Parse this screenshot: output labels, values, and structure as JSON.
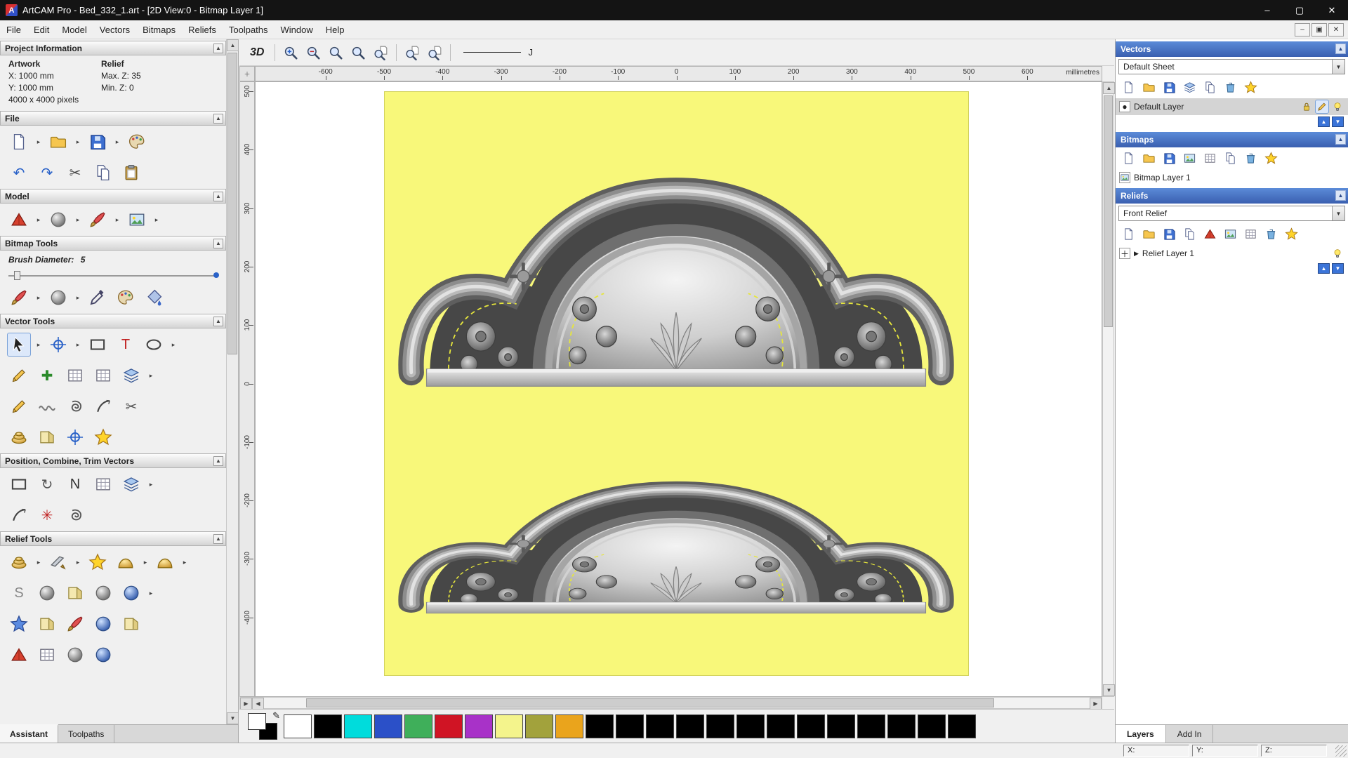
{
  "window": {
    "title": "ArtCAM Pro - Bed_332_1.art - [2D View:0 - Bitmap Layer 1]",
    "app_initial": "A",
    "minimize": "–",
    "maximize": "▢",
    "close": "✕",
    "mdi_minimize": "–",
    "mdi_restore": "▣",
    "mdi_close": "✕"
  },
  "menu_items": [
    "File",
    "Edit",
    "Model",
    "Vectors",
    "Bitmaps",
    "Reliefs",
    "Toolpaths",
    "Window",
    "Help"
  ],
  "toolbar": {
    "view_3d_label": "3D",
    "icons": [
      {
        "sep": true
      },
      {
        "name": "zoom-in-icon",
        "sym": "s-magplus"
      },
      {
        "name": "zoom-out-icon",
        "sym": "s-magminus"
      },
      {
        "name": "zoom-previous-icon",
        "sym": "s-mag"
      },
      {
        "name": "zoom-1to1-icon",
        "sym": "s-mag"
      },
      {
        "name": "zoom-selection-icon",
        "sym": "s-magpage"
      },
      {
        "sep": true
      },
      {
        "name": "zoom-fit-page-icon",
        "sym": "s-magpage"
      },
      {
        "name": "zoom-fit-drawing-icon",
        "sym": "s-magpage"
      }
    ]
  },
  "ruler": {
    "unit": "millimetres",
    "h_ticks": [
      -600,
      -500,
      -400,
      -300,
      -200,
      -100,
      0,
      100,
      200,
      300,
      400,
      500,
      600
    ],
    "v_ticks": [
      500,
      400,
      300,
      200,
      100,
      0,
      -100,
      -200,
      -300,
      -400
    ]
  },
  "left_panel": {
    "project_info": {
      "title": "Project Information",
      "artwork_heading": "Artwork",
      "relief_heading": "Relief",
      "artwork_x": "X: 1000 mm",
      "artwork_y": "Y: 1000 mm",
      "artwork_pixels": "4000 x 4000 pixels",
      "relief_max_z": "Max. Z: 35",
      "relief_min_z": "Min. Z: 0"
    },
    "sections": {
      "file": "File",
      "model": "Model",
      "bitmap_tools": "Bitmap Tools",
      "vector_tools": "Vector Tools",
      "position": "Position, Combine, Trim Vectors",
      "relief_tools": "Relief Tools"
    },
    "brush": {
      "label": "Brush Diameter:",
      "value": "5"
    },
    "icons": {
      "file_row1": [
        {
          "name": "new-model-icon",
          "sym": "s-page"
        },
        {
          "name": "flyout-arrow-icon",
          "glyph": "▸",
          "cls": "fly"
        },
        {
          "name": "open-model-icon",
          "sym": "s-folder"
        },
        {
          "name": "flyout-arrow-icon",
          "glyph": "▸",
          "cls": "fly"
        },
        {
          "name": "save-model-icon",
          "sym": "s-floppy"
        },
        {
          "name": "flyout-arrow-icon",
          "glyph": "▸",
          "cls": "fly"
        },
        {
          "name": "model-wizard-icon",
          "sym": "s-palette"
        }
      ],
      "file_row2": [
        {
          "name": "undo-icon",
          "glyph": "↶",
          "fg": "#2a62c8"
        },
        {
          "name": "redo-icon",
          "glyph": "↷",
          "fg": "#2a62c8"
        },
        {
          "name": "cut-icon",
          "glyph": "✂",
          "fg": "#444"
        },
        {
          "name": "copy-icon",
          "sym": "s-copy"
        },
        {
          "name": "paste-icon",
          "sym": "s-clipboard"
        }
      ],
      "model_row": [
        {
          "name": "set-model-size-icon",
          "sym": "s-pyramid"
        },
        {
          "name": "flyout-arrow-icon",
          "glyph": "▸",
          "cls": "fly"
        },
        {
          "name": "model-preview-icon",
          "sym": "s-sphere"
        },
        {
          "name": "flyout-arrow-icon",
          "glyph": "▸",
          "cls": "fly"
        },
        {
          "name": "scan-image-icon",
          "sym": "s-brush"
        },
        {
          "name": "flyout-arrow-icon",
          "glyph": "▸",
          "cls": "fly"
        },
        {
          "name": "load-picture-icon",
          "sym": "s-picture"
        },
        {
          "name": "flyout-arrow-icon",
          "glyph": "▸",
          "cls": "fly"
        }
      ],
      "bitmap_row": [
        {
          "name": "paint-brush-icon",
          "sym": "s-brush"
        },
        {
          "name": "flyout-arrow-icon",
          "glyph": "▸",
          "cls": "fly"
        },
        {
          "name": "replace-colour-icon",
          "sym": "s-sphere"
        },
        {
          "name": "flyout-arrow-icon",
          "glyph": "▸",
          "cls": "fly"
        },
        {
          "name": "colour-picker-icon",
          "sym": "s-dropper"
        },
        {
          "name": "reduce-colours-icon",
          "sym": "s-palette"
        },
        {
          "name": "flood-fill-icon",
          "sym": "s-bucket"
        }
      ],
      "vector_row1": [
        {
          "name": "select-vectors-icon",
          "sym": "s-cursor",
          "cls": "pressed"
        },
        {
          "name": "flyout-arrow-icon",
          "glyph": "▸",
          "cls": "fly"
        },
        {
          "name": "transform-vectors-icon",
          "sym": "s-crosshair"
        },
        {
          "name": "flyout-arrow-icon",
          "glyph": "▸",
          "cls": "fly"
        },
        {
          "name": "create-rectangle-icon",
          "sym": "s-rect"
        },
        {
          "name": "create-text-icon",
          "glyph": "T",
          "fg": "#c02020"
        },
        {
          "name": "create-ellipse-icon",
          "sym": "s-ellipse"
        },
        {
          "name": "flyout-arrow-icon",
          "glyph": "▸",
          "cls": "fly"
        }
      ],
      "vector_row2": [
        {
          "name": "freehand-polyline-icon",
          "sym": "s-pencil"
        },
        {
          "name": "add-cross-icon",
          "glyph": "✚",
          "fg": "#2a8a2a"
        },
        {
          "name": "text-in-box-icon",
          "sym": "s-grid"
        },
        {
          "name": "vector-grid-icon",
          "sym": "s-grid"
        },
        {
          "name": "block-array-icon",
          "sym": "s-layers"
        },
        {
          "name": "flyout-arrow-icon",
          "glyph": "▸",
          "cls": "fly"
        }
      ],
      "vector_row3": [
        {
          "name": "node-editing-icon",
          "sym": "s-pencil"
        },
        {
          "name": "smooth-polyline-icon",
          "sym": "s-wave"
        },
        {
          "name": "spline-fit-icon",
          "sym": "s-spiral"
        },
        {
          "name": "arc-tool-icon",
          "sym": "s-arc"
        },
        {
          "name": "knife-icon",
          "glyph": "✂",
          "fg": "#555"
        }
      ],
      "vector_row4": [
        {
          "name": "offset-vector-icon",
          "sym": "s-rings"
        },
        {
          "name": "profile-tool-icon",
          "sym": "s-fold"
        },
        {
          "name": "measure-tool-icon",
          "sym": "s-crosshair"
        },
        {
          "name": "magic-wand-icon",
          "sym": "s-star"
        }
      ],
      "position_row1": [
        {
          "name": "align-objects-icon",
          "sym": "s-rect"
        },
        {
          "name": "rotate-array-icon",
          "glyph": "↻",
          "fg": "#555"
        },
        {
          "name": "nesting-icon",
          "glyph": "N",
          "fg": "#333"
        },
        {
          "name": "paste-array-icon",
          "sym": "s-grid"
        },
        {
          "name": "group-vectors-icon",
          "sym": "s-layers"
        },
        {
          "name": "flyout-arrow-icon",
          "glyph": "▸",
          "cls": "fly"
        }
      ],
      "position_row2": [
        {
          "name": "mirror-vectors-icon",
          "sym": "s-arc"
        },
        {
          "name": "weld-vectors-icon",
          "glyph": "✳",
          "fg": "#c02020"
        },
        {
          "name": "wrap-vectors-icon",
          "sym": "s-spiral"
        }
      ],
      "relief_row1": [
        {
          "name": "zero-relief-icon",
          "sym": "s-rings"
        },
        {
          "name": "flyout-arrow-icon",
          "glyph": "▸",
          "cls": "fly"
        },
        {
          "name": "smooth-relief-icon",
          "sym": "s-chisel"
        },
        {
          "name": "flyout-arrow-icon",
          "glyph": "▸",
          "cls": "fly"
        },
        {
          "name": "sculpt-relief-icon",
          "sym": "s-star"
        },
        {
          "name": "add-relief-icon",
          "sym": "s-mound"
        },
        {
          "name": "flyout-arrow-icon",
          "glyph": "▸",
          "cls": "fly"
        },
        {
          "name": "merge-relief-icon",
          "sym": "s-mound"
        },
        {
          "name": "flyout-arrow-icon",
          "glyph": "▸",
          "cls": "fly"
        }
      ],
      "relief_row2": [
        {
          "name": "shape-editor-icon",
          "glyph": "S",
          "fg": "#888"
        },
        {
          "name": "texture-relief-icon",
          "sym": "s-sphere"
        },
        {
          "name": "offset-relief-icon",
          "sym": "s-fold"
        },
        {
          "name": "invert-relief-icon",
          "sym": "s-sphere"
        },
        {
          "name": "wrap-relief-icon",
          "sym": "s-sphereblue"
        },
        {
          "name": "flyout-arrow-icon",
          "glyph": "▸",
          "cls": "fly"
        }
      ],
      "relief_row3": [
        {
          "name": "star-relief-icon",
          "sym": "s-starblue"
        },
        {
          "name": "unwrap-relief-icon",
          "sym": "s-fold"
        },
        {
          "name": "paint-relief-icon",
          "sym": "s-brush"
        },
        {
          "name": "texture-ball-icon",
          "sym": "s-sphereblue"
        },
        {
          "name": "extract-relief-icon",
          "sym": "s-fold"
        }
      ],
      "relief_row4": [
        {
          "name": "red-relief-icon",
          "sym": "s-pyramid"
        },
        {
          "name": "mesh-relief-icon",
          "sym": "s-grid"
        },
        {
          "name": "dome-relief-icon",
          "sym": "s-sphere"
        },
        {
          "name": "blue-relief-icon",
          "sym": "s-sphereblue"
        }
      ]
    },
    "tabs": [
      {
        "label": "Assistant"
      },
      {
        "label": "Toolpaths"
      }
    ]
  },
  "right_panel": {
    "vectors": {
      "title": "Vectors",
      "sheet_selector": "Default Sheet",
      "layer_name": "Default Layer",
      "toolbar": [
        {
          "name": "new-vector-sheet-icon",
          "sym": "s-page"
        },
        {
          "name": "open-vectors-icon",
          "sym": "s-folder"
        },
        {
          "name": "save-vectors-icon",
          "sym": "s-floppy"
        },
        {
          "name": "import-vectors-icon",
          "sym": "s-layers"
        },
        {
          "name": "export-vectors-icon",
          "sym": "s-copy"
        },
        {
          "name": "delete-vector-layer-icon",
          "sym": "s-trash"
        },
        {
          "name": "vector-options-icon",
          "sym": "s-star"
        }
      ],
      "layer_actions": [
        {
          "name": "lock-layer-icon",
          "sym": "s-lock"
        },
        {
          "name": "edit-layer-icon",
          "sym": "s-pencil",
          "cls": "pressed"
        },
        {
          "name": "toggle-visibility-icon",
          "sym": "s-bulb"
        }
      ]
    },
    "bitmaps": {
      "title": "Bitmaps",
      "layer_name": "Bitmap Layer 1",
      "toolbar": [
        {
          "name": "new-bitmap-layer-icon",
          "sym": "s-page"
        },
        {
          "name": "open-bitmap-icon",
          "sym": "s-folder"
        },
        {
          "name": "save-bitmap-icon",
          "sym": "s-floppy"
        },
        {
          "name": "bitmap-to-vector-icon",
          "sym": "s-picture"
        },
        {
          "name": "bitmap-contrast-icon",
          "sym": "s-grid"
        },
        {
          "name": "merge-bitmap-icon",
          "sym": "s-copy"
        },
        {
          "name": "delete-bitmap-layer-icon",
          "sym": "s-trash"
        },
        {
          "name": "bitmap-options-icon",
          "sym": "s-star"
        }
      ]
    },
    "reliefs": {
      "title": "Reliefs",
      "relief_selector": "Front Relief",
      "layer_name": "Relief Layer 1",
      "toolbar": [
        {
          "name": "new-relief-layer-icon",
          "sym": "s-page"
        },
        {
          "name": "open-relief-icon",
          "sym": "s-folder"
        },
        {
          "name": "save-relief-icon",
          "sym": "s-floppy"
        },
        {
          "name": "duplicate-relief-icon",
          "sym": "s-copy"
        },
        {
          "name": "triangle-mesh-icon",
          "sym": "s-pyramid"
        },
        {
          "name": "relief-preview-icon",
          "sym": "s-picture"
        },
        {
          "name": "mesh-icon",
          "sym": "s-grid"
        },
        {
          "name": "delete-relief-layer-icon",
          "sym": "s-trash"
        },
        {
          "name": "relief-options-icon",
          "sym": "s-star"
        }
      ],
      "layer_actions": [
        {
          "name": "toggle-visibility-icon",
          "sym": "s-bulb"
        }
      ]
    },
    "tabs": [
      {
        "label": "Layers"
      },
      {
        "label": "Add In"
      }
    ]
  },
  "palette": {
    "swatches": [
      "#ffffff",
      "#000000",
      "#00dcdc",
      "#2b50c8",
      "#3faf5a",
      "#d01424",
      "#a832c8",
      "#f4f48c",
      "#a2a23c",
      "#eaa41c",
      "#000000",
      "#000000",
      "#000000",
      "#000000",
      "#000000",
      "#000000",
      "#000000",
      "#000000",
      "#000000",
      "#000000",
      "#000000",
      "#000000",
      "#000000"
    ]
  },
  "status_bar": {
    "x_label": "X:",
    "y_label": "Y:",
    "z_label": "Z:"
  }
}
